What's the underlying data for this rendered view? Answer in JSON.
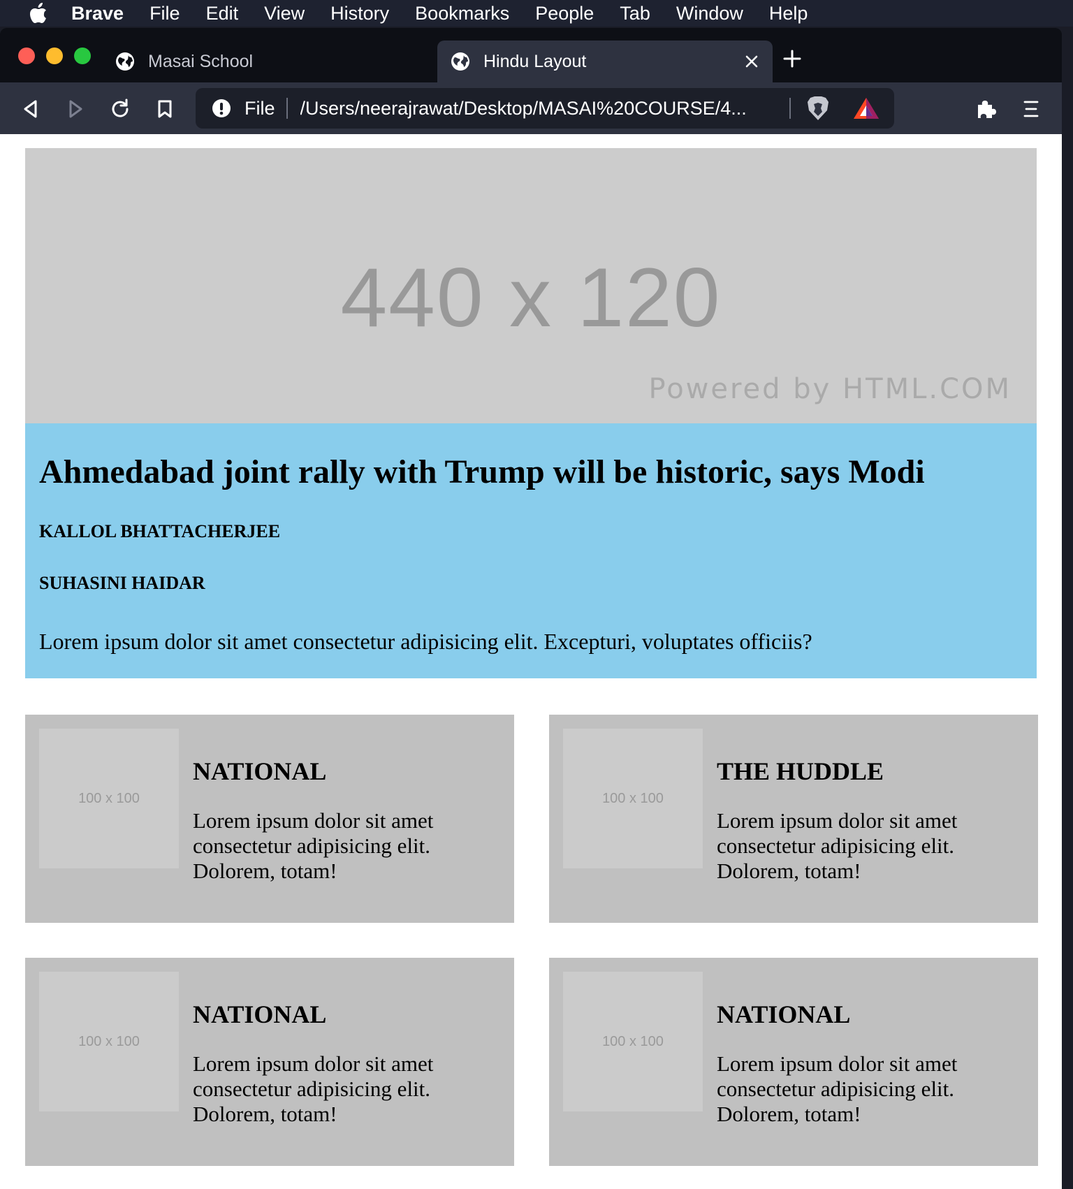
{
  "menubar": {
    "app_name": "Brave",
    "items": [
      "File",
      "Edit",
      "View",
      "History",
      "Bookmarks",
      "People",
      "Tab",
      "Window",
      "Help"
    ]
  },
  "browser": {
    "tabs": [
      {
        "title": "Masai School",
        "active": false
      },
      {
        "title": "Hindu Layout",
        "active": true
      }
    ],
    "address": {
      "scheme_label": "File",
      "url": "/Users/neerajrawat/Desktop/MASAI%20COURSE/4..."
    }
  },
  "page": {
    "banner": {
      "size_text": "440 x 120",
      "powered_text": "Powered by HTML.COM"
    },
    "article": {
      "headline": "Ahmedabad joint rally with Trump will be historic, says Modi",
      "authors": [
        "KALLOL BHATTACHERJEE",
        "SUHASINI HAIDAR"
      ],
      "body": "Lorem ipsum dolor sit amet consectetur adipisicing elit. Excepturi, voluptates officiis?"
    },
    "cards": [
      {
        "thumb": "100 x 100",
        "title": "NATIONAL",
        "text": "Lorem ipsum dolor sit amet consectetur adipisicing elit. Dolorem, totam!"
      },
      {
        "thumb": "100 x 100",
        "title": "THE HUDDLE",
        "text": "Lorem ipsum dolor sit amet consectetur adipisicing elit. Dolorem, totam!"
      },
      {
        "thumb": "100 x 100",
        "title": "NATIONAL",
        "text": "Lorem ipsum dolor sit amet consectetur adipisicing elit. Dolorem, totam!"
      },
      {
        "thumb": "100 x 100",
        "title": "NATIONAL",
        "text": "Lorem ipsum dolor sit amet consectetur adipisicing elit. Dolorem, totam!"
      }
    ]
  }
}
